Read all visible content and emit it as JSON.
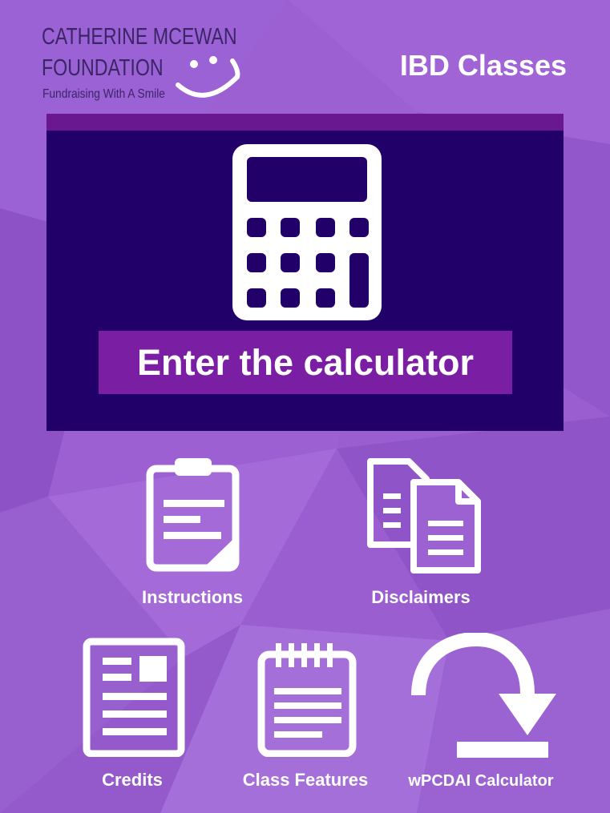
{
  "logo": {
    "line1": "CATHERINE MCEWAN",
    "line2": "FOUNDATION",
    "tagline": "Fundraising With A Smile"
  },
  "header": {
    "title": "IBD Classes"
  },
  "hero": {
    "label": "Enter the calculator",
    "icon": "calculator-icon"
  },
  "tiles": [
    {
      "label": "Instructions",
      "icon": "clipboard-icon"
    },
    {
      "label": "Disclaimers",
      "icon": "documents-icon"
    },
    {
      "label": "Credits",
      "icon": "newspaper-icon"
    },
    {
      "label": "Class Features",
      "icon": "notepad-icon"
    },
    {
      "label": "wPCDAI Calculator",
      "icon": "curved-download-arrow-icon"
    }
  ],
  "colors": {
    "background": "#9a5fcf",
    "hero_panel": "#22006a",
    "hero_strip": "#6a1890",
    "hero_label_bg": "#7a1ea3",
    "logo_text": "#3b2566",
    "text": "#ffffff"
  }
}
